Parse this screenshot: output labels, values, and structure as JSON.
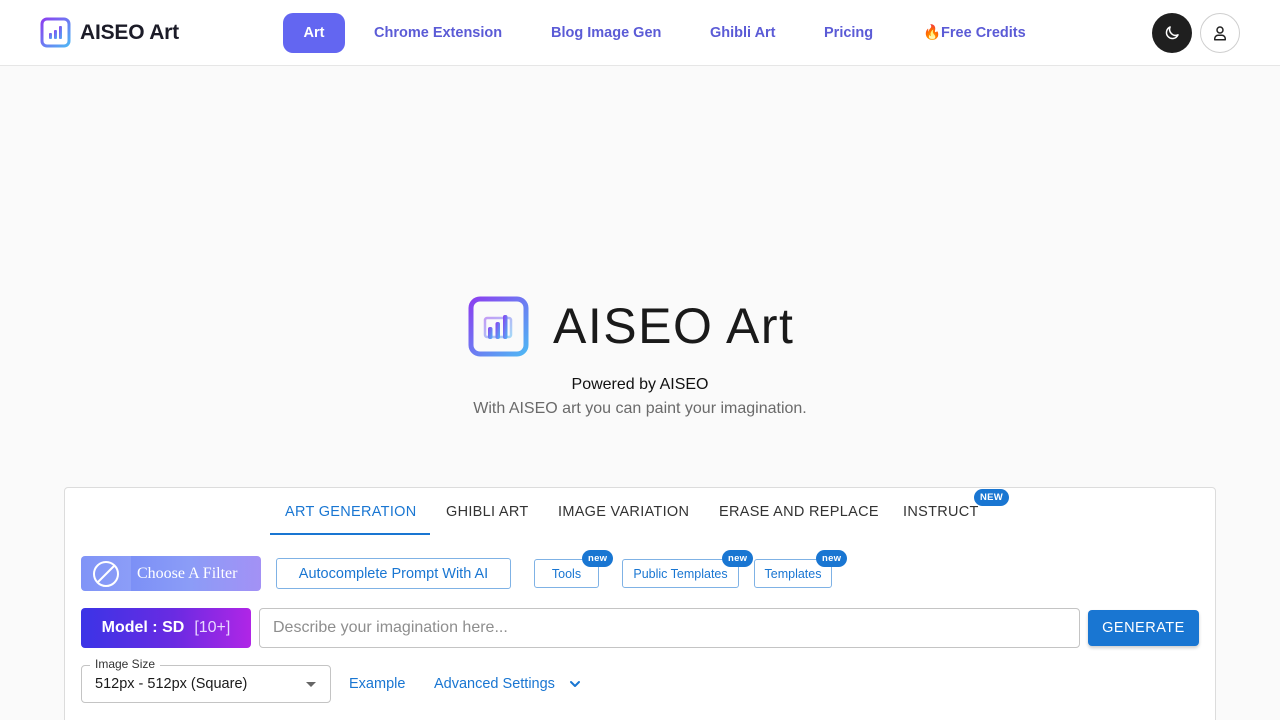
{
  "header": {
    "brand_name": "AISEO Art",
    "nav": [
      {
        "label": "Art",
        "active": true
      },
      {
        "label": "Chrome Extension"
      },
      {
        "label": "Blog Image Gen"
      },
      {
        "label": "Ghibli Art"
      },
      {
        "label": "Pricing"
      },
      {
        "label": "🔥Free Credits"
      }
    ],
    "icons": {
      "theme_toggle": "moon-icon",
      "account": "user-icon"
    }
  },
  "hero": {
    "title": "AISEO Art",
    "powered_by": "Powered by AISEO",
    "tagline": "With AISEO art you can paint your imagination."
  },
  "tabs": [
    {
      "label": "ART GENERATION",
      "active": true
    },
    {
      "label": "GHIBLI ART"
    },
    {
      "label": "IMAGE VARIATION"
    },
    {
      "label": "ERASE AND REPLACE"
    },
    {
      "label": "INSTRUCT",
      "badge": "NEW"
    }
  ],
  "toolbar": {
    "filter_label": "Choose A Filter",
    "autocomplete_label": "Autocomplete Prompt With AI",
    "tools_label": "Tools",
    "public_templates_label": "Public Templates",
    "templates_label": "Templates",
    "new_badge": "new"
  },
  "prompt": {
    "model_label": "Model : SD",
    "model_count": "[10+]",
    "placeholder": "Describe your imagination here...",
    "generate_label": "GENERATE"
  },
  "settings": {
    "image_size_label": "Image Size",
    "image_size_value": "512px - 512px (Square)",
    "example_label": "Example",
    "advanced_label": "Advanced Settings"
  },
  "colors": {
    "accent": "#6366f1",
    "link": "#1976d2",
    "nav_text": "#5b5bd6"
  }
}
